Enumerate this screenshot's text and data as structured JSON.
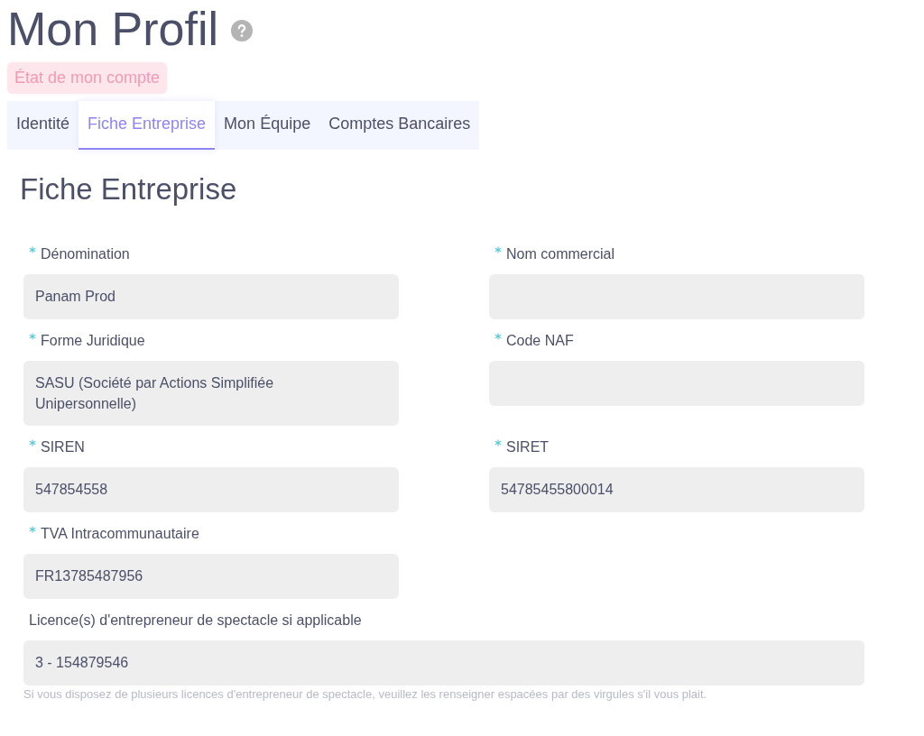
{
  "page": {
    "title": "Mon Profil",
    "account_status": "État de mon compte"
  },
  "tabs": [
    {
      "label": "Identité",
      "selected": false
    },
    {
      "label": "Fiche Entreprise",
      "selected": true
    },
    {
      "label": "Mon Équipe",
      "selected": false
    },
    {
      "label": "Comptes Bancaires",
      "selected": false
    }
  ],
  "section": {
    "title": "Fiche Entreprise"
  },
  "fields": [
    {
      "label": "Dénomination",
      "required": true,
      "value": "Panam Prod",
      "kind": "half"
    },
    {
      "label": "Nom commercial",
      "required": true,
      "kind": "half"
    },
    {
      "label": "Forme Juridique",
      "required": true,
      "value": "SASU (Société par Actions Simplifiée Unipersonnelle)",
      "kind": "half"
    },
    {
      "label": "Code NAF",
      "required": true,
      "kind": "half"
    },
    {
      "label": "SIREN",
      "required": true,
      "value": "547854558",
      "kind": "half"
    },
    {
      "label": "SIRET",
      "required": true,
      "value": "54785455800014",
      "kind": "half"
    },
    {
      "label": "TVA Intracommunautaire",
      "required": true,
      "value": "FR13785487956",
      "kind": "half"
    },
    {
      "label": "Licence(s) d'entrepreneur de spectacle si applicable",
      "required": false,
      "value": "3 - 154879546",
      "kind": "full",
      "help": "Si vous disposez de plusieurs licences d'entrepreneur de spectacle, veuillez les renseigner espacées par des virgules s'il vous plait."
    }
  ]
}
